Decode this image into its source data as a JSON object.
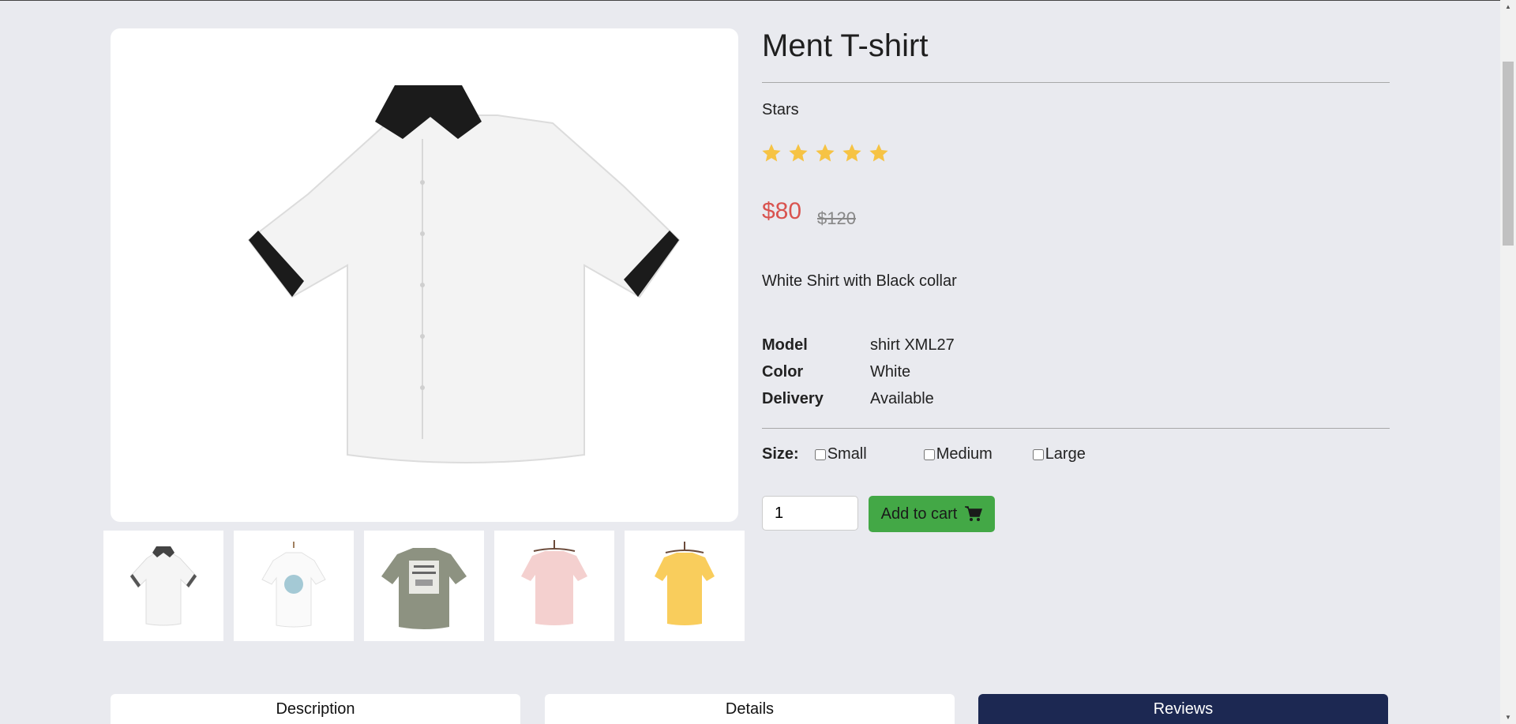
{
  "product": {
    "title": "Ment T-shirt",
    "stars_label": "Stars",
    "rating": 5,
    "rating_max": 5,
    "price": "$80",
    "old_price": "$120",
    "description": "White Shirt with Black collar",
    "specs": [
      {
        "key": "Model",
        "value": "shirt XML27"
      },
      {
        "key": "Color",
        "value": "White"
      },
      {
        "key": "Delivery",
        "value": "Available"
      }
    ],
    "size_label": "Size:",
    "sizes": [
      "Small",
      "Medium",
      "Large"
    ],
    "quantity": "1",
    "add_to_cart_label": "Add to cart"
  },
  "thumbnails": [
    {
      "icon": "white-shirt-black-collar-thumbnail"
    },
    {
      "icon": "white-tshirt-graphic-thumbnail"
    },
    {
      "icon": "grey-tshirt-print-thumbnail"
    },
    {
      "icon": "pink-tshirt-thumbnail"
    },
    {
      "icon": "yellow-tshirt-thumbnail"
    }
  ],
  "tabs": [
    {
      "label": "Description",
      "active": false
    },
    {
      "label": "Details",
      "active": false
    },
    {
      "label": "Reviews",
      "active": true
    }
  ],
  "colors": {
    "star": "#f6c344",
    "price": "#d9534f",
    "add_to_cart": "#43a846",
    "active_tab": "#1c2852"
  }
}
